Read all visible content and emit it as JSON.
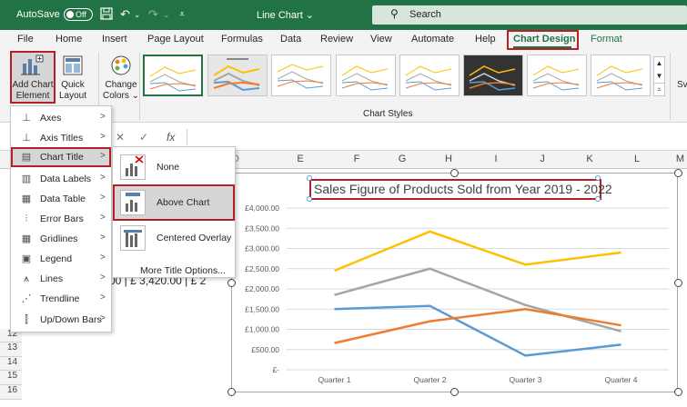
{
  "titlebar": {
    "autosave_label": "AutoSave",
    "autosave_state": "Off",
    "doc_title": "Line Chart ⌄",
    "search_placeholder": "Search"
  },
  "tabs": [
    "File",
    "Home",
    "Insert",
    "Page Layout",
    "Formulas",
    "Data",
    "Review",
    "View",
    "Automate",
    "Help",
    "Chart Design",
    "Format"
  ],
  "ribbon": {
    "add_chart_element": [
      "Add Chart",
      "Element ⌄"
    ],
    "quick_layout": [
      "Quick",
      "Layout ⌄"
    ],
    "change_colors": [
      "Change",
      "Colors ⌄"
    ],
    "chart_styles_label": "Chart Styles",
    "cut_off_label": "Sv"
  },
  "columns": [
    "E",
    "F",
    "G",
    "H",
    "I",
    "J",
    "K",
    "L",
    "M"
  ],
  "rows": [
    "12",
    "13",
    "14",
    "15",
    "16"
  ],
  "partial_cell_text": "00 | £ 3,420.00 | £ 2",
  "menu": {
    "items": [
      {
        "label": "Axes",
        "icon": "axes-icon"
      },
      {
        "label": "Axis Titles",
        "icon": "axis-titles-icon"
      },
      {
        "label": "Chart Title",
        "icon": "chart-title-icon"
      },
      {
        "label": "Data Labels",
        "icon": "data-labels-icon"
      },
      {
        "label": "Data Table",
        "icon": "data-table-icon"
      },
      {
        "label": "Error Bars",
        "icon": "error-bars-icon"
      },
      {
        "label": "Gridlines",
        "icon": "gridlines-icon"
      },
      {
        "label": "Legend",
        "icon": "legend-icon"
      },
      {
        "label": "Lines",
        "icon": "lines-icon"
      },
      {
        "label": "Trendline",
        "icon": "trendline-icon"
      },
      {
        "label": "Up/Down Bars",
        "icon": "updown-bars-icon"
      }
    ],
    "highlighted": "Chart Title"
  },
  "submenu": {
    "items": [
      "None",
      "Above Chart",
      "Centered Overlay"
    ],
    "highlighted": "Above Chart",
    "more": "More Title Options..."
  },
  "colors": {
    "brand": "#217346",
    "highlight_border": "#b32026",
    "series_1": "#5b9bd5",
    "series_2": "#ed7d31",
    "series_3": "#a5a5a5",
    "series_4": "#ffc000"
  },
  "chart_data": {
    "type": "line",
    "title": "Sales Figure of Products Sold from Year 2019 - 2022",
    "categories": [
      "Quarter 1",
      "Quarter 2",
      "Quarter 3",
      "Quarter 4"
    ],
    "series": [
      {
        "values": [
          2450,
          3420,
          2600,
          2900
        ]
      },
      {
        "values": [
          1850,
          2500,
          1600,
          950
        ]
      },
      {
        "values": [
          1500,
          1580,
          350,
          620
        ]
      },
      {
        "values": [
          660,
          1200,
          1500,
          1100
        ]
      }
    ],
    "y_ticks": [
      "£-",
      "£500.00",
      "£1,000.00",
      "£1,500.00",
      "£2,000.00",
      "£2,500.00",
      "£3,000.00",
      "£3,500.00",
      "£4,000.00"
    ],
    "ylim": [
      0,
      4000
    ],
    "grid": true,
    "legend": "none"
  }
}
